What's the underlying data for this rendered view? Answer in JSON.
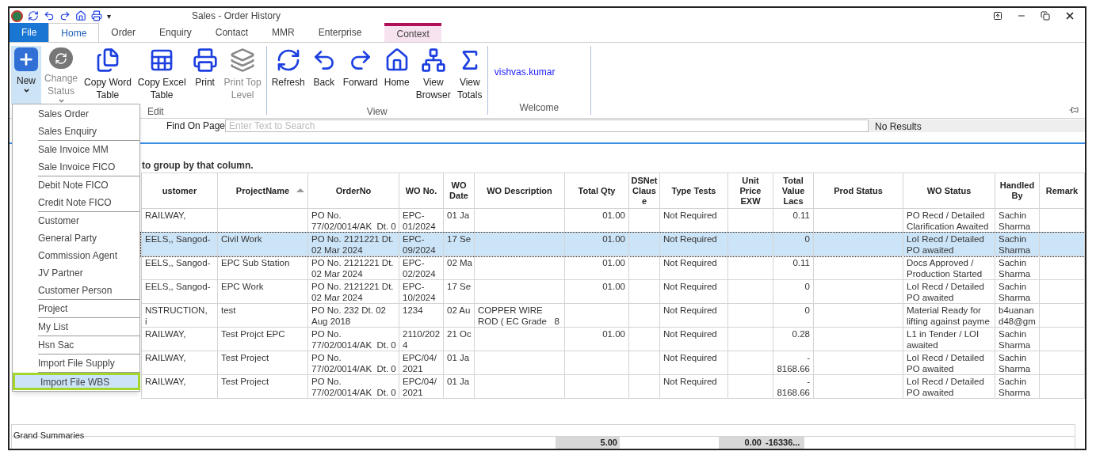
{
  "window": {
    "title": "Sales - Order History"
  },
  "quick_access": {
    "more": "▾"
  },
  "tabs": [
    {
      "label": "File",
      "kind": "file",
      "selected": false
    },
    {
      "label": "Home",
      "kind": "tab",
      "selected": true
    },
    {
      "label": "Order",
      "kind": "tab",
      "selected": false
    },
    {
      "label": "Enquiry",
      "kind": "tab",
      "selected": false
    },
    {
      "label": "Contact",
      "kind": "tab",
      "selected": false
    },
    {
      "label": "MMR",
      "kind": "tab",
      "selected": false
    },
    {
      "label": "Enterprise",
      "kind": "tab",
      "selected": false
    },
    {
      "label": "Context",
      "kind": "context",
      "selected": false
    }
  ],
  "ribbon": {
    "groups": [
      {
        "label": "Edit",
        "buttons": [
          {
            "lines": [
              "New"
            ],
            "dropdown": true,
            "open": true,
            "disabled": false
          },
          {
            "lines": [
              "Change",
              "Status"
            ],
            "dropdown": true,
            "open": false,
            "disabled": true
          },
          {
            "lines": [
              "Copy Word",
              "Table"
            ],
            "dropdown": false,
            "open": false,
            "disabled": false
          },
          {
            "lines": [
              "Copy Excel",
              "Table"
            ],
            "dropdown": false,
            "open": false,
            "disabled": false
          },
          {
            "lines": [
              "Print"
            ],
            "dropdown": false,
            "open": false,
            "disabled": false
          },
          {
            "lines": [
              "Print Top",
              "Level"
            ],
            "dropdown": false,
            "open": false,
            "disabled": true
          }
        ]
      },
      {
        "label": "View",
        "buttons": [
          {
            "lines": [
              "Refresh"
            ],
            "dropdown": false,
            "open": false,
            "disabled": false
          },
          {
            "lines": [
              "Back"
            ],
            "dropdown": false,
            "open": false,
            "disabled": false
          },
          {
            "lines": [
              "Forward"
            ],
            "dropdown": false,
            "open": false,
            "disabled": false
          },
          {
            "lines": [
              "Home"
            ],
            "dropdown": false,
            "open": false,
            "disabled": false
          },
          {
            "lines": [
              "View",
              "Browser"
            ],
            "dropdown": false,
            "open": false,
            "disabled": false
          },
          {
            "lines": [
              "View",
              "Totals"
            ],
            "dropdown": false,
            "open": false,
            "disabled": false
          }
        ]
      }
    ],
    "welcome": {
      "label": "Welcome",
      "user": "vishvas.kumar"
    }
  },
  "find": {
    "label": "Find On Page",
    "placeholder": "Enter Text to Search",
    "result": "No Results"
  },
  "group_hint": "to group by that column.",
  "new_menu": [
    [
      {
        "label": "Sales Order",
        "selected": false
      },
      {
        "label": "Sales Enquiry",
        "selected": false
      }
    ],
    [
      {
        "label": "Sale Invoice MM",
        "selected": false
      },
      {
        "label": "Sale Invoice FICO",
        "selected": false
      }
    ],
    [
      {
        "label": "Debit Note FICO",
        "selected": false
      },
      {
        "label": "Credit Note FICO",
        "selected": false
      }
    ],
    [
      {
        "label": "Customer",
        "selected": false
      },
      {
        "label": "General Party",
        "selected": false
      },
      {
        "label": "Commission Agent",
        "selected": false
      },
      {
        "label": "JV Partner",
        "selected": false
      },
      {
        "label": "Customer Person",
        "selected": false
      }
    ],
    [
      {
        "label": "Project",
        "selected": false
      }
    ],
    [
      {
        "label": "My List",
        "selected": false
      }
    ],
    [
      {
        "label": "Hsn Sac",
        "selected": false
      }
    ],
    [
      {
        "label": "Import File Supply",
        "selected": false
      }
    ],
    [
      {
        "label": "Import File WBS",
        "selected": true
      }
    ]
  ],
  "table": {
    "columns": [
      {
        "label": "ustomer",
        "sorted": false
      },
      {
        "label": "ProjectName",
        "sorted": true
      },
      {
        "label": "OrderNo",
        "sorted": false
      },
      {
        "label": "WO No.",
        "sorted": false
      },
      {
        "label": "WO\nDate",
        "sorted": false
      },
      {
        "label": "WO Description",
        "sorted": false
      },
      {
        "label": "Total Qty",
        "sorted": false
      },
      {
        "label": "DSNet\nClaus\ne",
        "sorted": false
      },
      {
        "label": "Type Tests",
        "sorted": false
      },
      {
        "label": "Unit\nPrice\nEXW",
        "sorted": false
      },
      {
        "label": "Total\nValue\nLacs",
        "sorted": false
      },
      {
        "label": "Prod Status",
        "sorted": false
      },
      {
        "label": "WO Status",
        "sorted": false
      },
      {
        "label": "Handled\nBy",
        "sorted": false
      },
      {
        "label": "Remark",
        "sorted": false
      }
    ],
    "rows": [
      {
        "selected": false,
        "customer": "RAILWAY,",
        "order_no": "PO No.\n77/02/0014/AK  Dt. 0",
        "wo_no": "EPC-\n01/2024",
        "wo_date": "01 Ja",
        "total_qty": "01.00",
        "type_tests": "Not Required",
        "total_value_lacs": "0.11",
        "wo_status": "PO Recd / Detailed\nClarification Awaited",
        "handled_by": "Sachin\nSharma"
      },
      {
        "selected": true,
        "customer": "EELS,, Sangod-",
        "project_name": "Civil Work",
        "order_no": "PO No. 2121221 Dt.\n02 Mar 2024",
        "wo_no": "EPC-\n09/2024",
        "wo_date": "17 Se",
        "total_qty": "01.00",
        "type_tests": "Not Required",
        "total_value_lacs": "0",
        "wo_status": "LoI Recd / Detailed\nPO awaited",
        "handled_by": "Sachin\nSharma"
      },
      {
        "selected": false,
        "customer": "EELS,, Sangod-",
        "project_name": "EPC Sub Station",
        "order_no": "PO No. 2121221 Dt.\n02 Mar 2024",
        "wo_no": "EPC-\n02/2024",
        "wo_date": "02 Ma",
        "total_qty": "01.00",
        "type_tests": "Not Required",
        "total_value_lacs": "0.11",
        "wo_status": "Docs Approved /\nProduction Started",
        "handled_by": "Sachin\nSharma"
      },
      {
        "selected": false,
        "customer": "EELS,, Sangod-",
        "project_name": "EPC Work",
        "order_no": "PO No. 2121221 Dt.\n02 Mar 2024",
        "wo_no": "EPC-\n10/2024",
        "wo_date": "17 Se",
        "total_qty": "01.00",
        "type_tests": "Not Required",
        "total_value_lacs": "0",
        "wo_status": "LoI Recd / Detailed\nPO awaited",
        "handled_by": "Sachin\nSharma"
      },
      {
        "selected": false,
        "customer": "NSTRUCTION,\ni",
        "project_name": "test",
        "order_no": "PO No. 232 Dt. 02\nAug 2018",
        "wo_no": "1234",
        "wo_date": "02 Au",
        "wo_description": "COPPER WIRE\nROD ( EC Grade   8",
        "type_tests": "Not Required",
        "total_value_lacs": "0",
        "wo_status": "Material Ready for\nlifting against payme",
        "handled_by": "b4uanan\nd48@gm"
      },
      {
        "selected": false,
        "customer": "RAILWAY,",
        "project_name": "Test Projct EPC",
        "order_no": "PO No.\n77/02/0014/AK  Dt. 0",
        "wo_no": "2110/202\n4",
        "wo_date": "21 Oc",
        "total_qty": "01.00",
        "type_tests": "Not Required",
        "total_value_lacs": "0.28",
        "wo_status": "L1 in Tender / LOI\nawaited",
        "handled_by": "Sachin\nSharma"
      },
      {
        "selected": false,
        "customer": "RAILWAY,",
        "project_name": "Test Project",
        "order_no": "PO No.\n77/02/0014/AK  Dt. 0",
        "wo_no": "EPC/04/\n2021",
        "wo_date": "01 Ja",
        "type_tests": "Not Required",
        "total_value_lacs": "-\n8168.66",
        "wo_status": "LoI Recd / Detailed\nPO awaited",
        "handled_by": "Sachin\nSharma"
      },
      {
        "selected": false,
        "customer": "RAILWAY,",
        "project_name": "Test Project",
        "order_no": "PO No.\n77/02/0014/AK  Dt. 0",
        "wo_no": "EPC/04/\n2021",
        "wo_date": "01 Ja",
        "type_tests": "Not Required",
        "total_value_lacs": "-\n8168.66",
        "wo_status": "LoI Recd / Detailed\nPO awaited",
        "handled_by": "Sachin\nSharma"
      }
    ]
  },
  "summaries": {
    "label": "Grand Summaries",
    "total_qty": "5.00",
    "unit_price_exw": "0.00",
    "total_value_lacs": "-16336..."
  }
}
